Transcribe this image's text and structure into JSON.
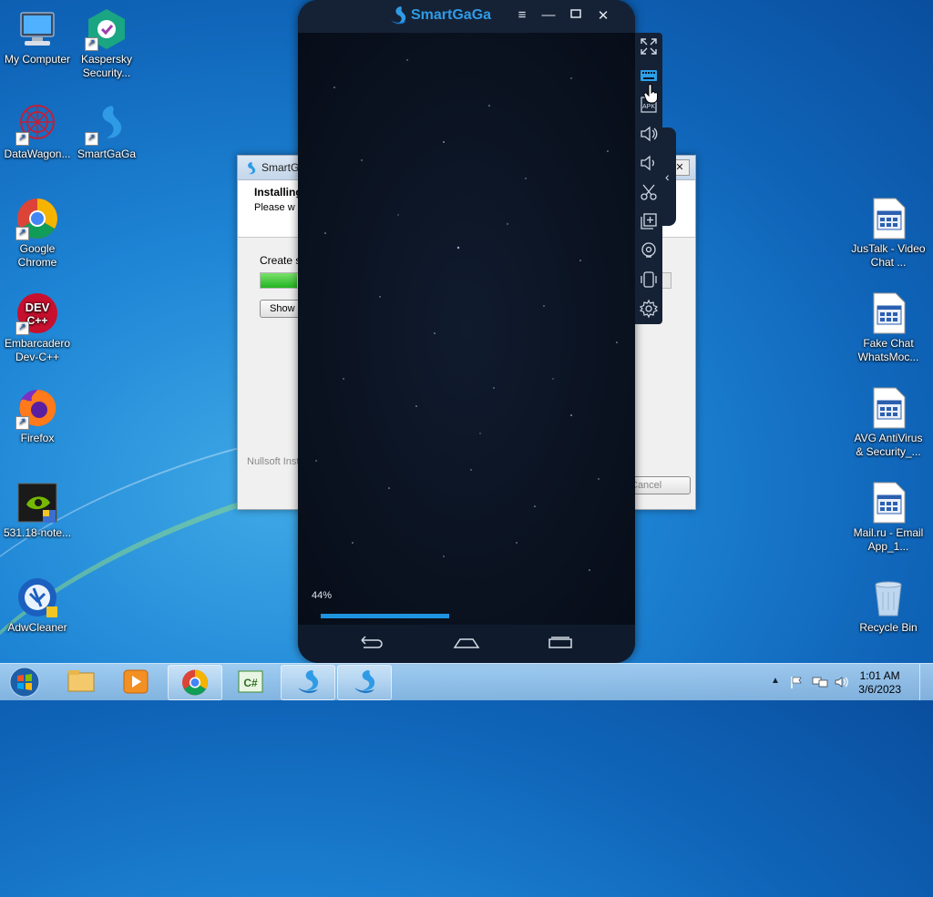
{
  "desktop": {
    "left_icons": [
      {
        "label": "My Computer",
        "icon": "computer-icon"
      },
      {
        "label": "Kaspersky Security...",
        "icon": "kaspersky-icon"
      },
      {
        "label": "DataWagon...",
        "icon": "datawagon-icon"
      },
      {
        "label": "SmartGaGa",
        "icon": "smartgaga-icon"
      },
      {
        "label": "Google Chrome",
        "icon": "chrome-icon"
      },
      {
        "label": "Embarcadero Dev-C++",
        "icon": "devcpp-icon"
      },
      {
        "label": "Firefox",
        "icon": "firefox-icon"
      },
      {
        "label": "531.18-note...",
        "icon": "nvidia-icon"
      },
      {
        "label": "AdwCleaner",
        "icon": "adwcleaner-icon"
      }
    ],
    "right_icons": [
      {
        "label": "JusTalk - Video Chat ...",
        "icon": "app-file-icon"
      },
      {
        "label": "Fake Chat WhatsMoc...",
        "icon": "app-file-icon"
      },
      {
        "label": "AVG AntiVirus & Security_...",
        "icon": "app-file-icon"
      },
      {
        "label": "Mail.ru - Email App_1...",
        "icon": "app-file-icon"
      },
      {
        "label": "Recycle Bin",
        "icon": "recycle-bin-icon"
      }
    ]
  },
  "installer": {
    "title": "SmartGa",
    "header_title": "Installing",
    "header_sub": "Please w",
    "status": "Create s",
    "show_button": "Show",
    "footer": "Nullsoft Inst",
    "cancel_button": "Cancel"
  },
  "emulator": {
    "brand": "SmartGaGa",
    "loading_percent": "44%",
    "loading_value": 44,
    "accent": "#1f93e0"
  },
  "taskbar": {
    "time": "1:01 AM",
    "date": "3/6/2023"
  }
}
